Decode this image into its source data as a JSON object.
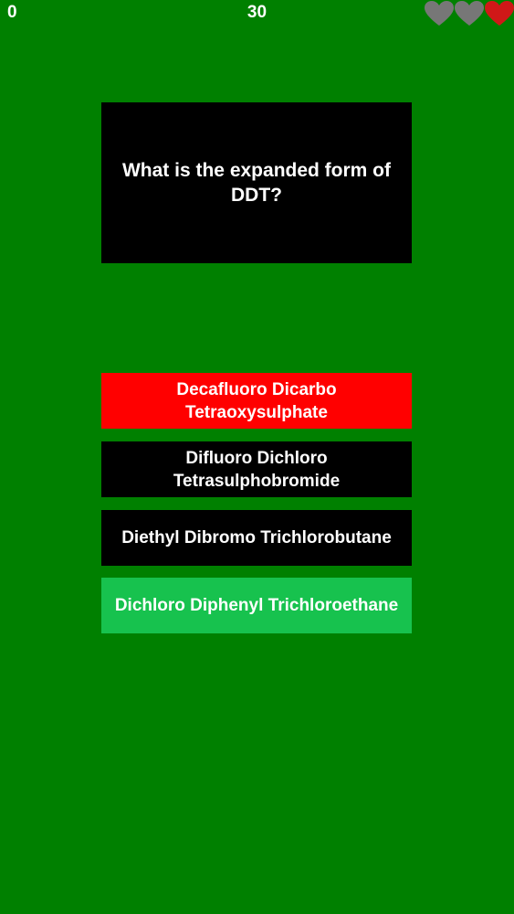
{
  "hud": {
    "score": "0",
    "timer": "30",
    "lives": [
      {
        "state": "lost",
        "icon": "heart-icon",
        "color": "#777777"
      },
      {
        "state": "lost",
        "icon": "heart-icon",
        "color": "#777777"
      },
      {
        "state": "active",
        "icon": "heart-icon",
        "color": "#d01818"
      }
    ]
  },
  "question": {
    "text": "What is the expanded form of DDT?"
  },
  "answers": [
    {
      "label": "Decafluoro Dicarbo Tetraoxysulphate",
      "state": "wrong",
      "color": "#ff0000"
    },
    {
      "label": "Difluoro Dichloro Tetrasulphobromide",
      "state": "neutral",
      "color": "#000000"
    },
    {
      "label": "Diethyl Dibromo Trichlorobutane",
      "state": "neutral",
      "color": "#000000"
    },
    {
      "label": "Dichloro Diphenyl Trichloroethane",
      "state": "correct",
      "color": "#17c24e"
    }
  ],
  "colors": {
    "background": "#008000",
    "text": "#ffffff"
  }
}
